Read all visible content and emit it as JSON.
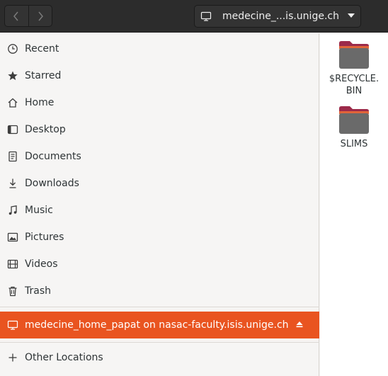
{
  "header": {
    "back_icon": "chevron-left-icon",
    "forward_icon": "chevron-right-icon",
    "path_label": "medecine_...is.unige.ch",
    "path_icon": "network-drive-icon",
    "path_menu_icon": "caret-down-icon"
  },
  "sidebar": {
    "items": [
      {
        "label": "Recent",
        "icon": "clock-icon"
      },
      {
        "label": "Starred",
        "icon": "star-icon"
      },
      {
        "label": "Home",
        "icon": "home-icon"
      },
      {
        "label": "Desktop",
        "icon": "desktop-icon"
      },
      {
        "label": "Documents",
        "icon": "document-icon"
      },
      {
        "label": "Downloads",
        "icon": "download-icon"
      },
      {
        "label": "Music",
        "icon": "music-icon"
      },
      {
        "label": "Pictures",
        "icon": "pictures-icon"
      },
      {
        "label": "Videos",
        "icon": "video-icon"
      },
      {
        "label": "Trash",
        "icon": "trash-icon"
      }
    ],
    "mount": {
      "label": "medecine_home_papat on nasac-faculty.isis.unige.ch",
      "icon": "network-drive-icon",
      "eject_icon": "eject-icon"
    },
    "other_locations": {
      "label": "Other Locations",
      "icon": "plus-icon"
    }
  },
  "files": [
    {
      "name": "$RECYCLE.\nBIN",
      "icon": "folder-icon"
    },
    {
      "name": "SLIMS",
      "icon": "folder-icon"
    }
  ],
  "colors": {
    "accent": "#e95420",
    "header_bg": "#2c2c2c",
    "sidebar_bg": "#f6f5f4",
    "folder_body": "#6a6a6a",
    "folder_tab": "#9c2a4a"
  }
}
